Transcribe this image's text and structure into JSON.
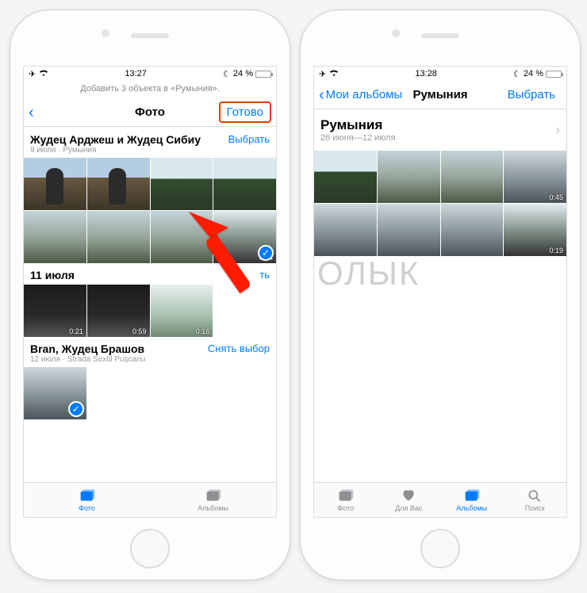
{
  "left": {
    "status": {
      "time": "13:27",
      "battery": "24 %"
    },
    "banner": "Добавить 3 объекта в «Румыния».",
    "nav": {
      "title": "Фото",
      "done": "Готово"
    },
    "sections": [
      {
        "title": "Жудец Арджеш и Жудец Сибиу",
        "sub": "9 июля · Румыния",
        "action": "Выбрать",
        "row2_last_dur": "0:14"
      },
      {
        "title": "11 июля",
        "action": "ть",
        "durs": [
          "0:21",
          "0:59",
          "0:16"
        ]
      },
      {
        "title": "Bran, Жудец Брашов",
        "sub": "12 июля · Strada Sextil Pușcariu",
        "action": "Снять выбор"
      }
    ],
    "tabs": {
      "photos": "Фото",
      "albums": "Альбомы"
    }
  },
  "right": {
    "status": {
      "time": "13:28",
      "battery": "24 %"
    },
    "nav": {
      "back": "Мои альбомы",
      "title": "Румыния",
      "action": "Выбрать"
    },
    "card": {
      "title": "Румыния",
      "sub": "26 июня—12 июля"
    },
    "durs": {
      "r1c4": "0:45",
      "r2c4": "0:19"
    },
    "tabs": {
      "photos": "Фото",
      "foryou": "Для Вас",
      "albums": "Альбомы",
      "search": "Поиск"
    }
  },
  "watermark": "ОЛЫК"
}
